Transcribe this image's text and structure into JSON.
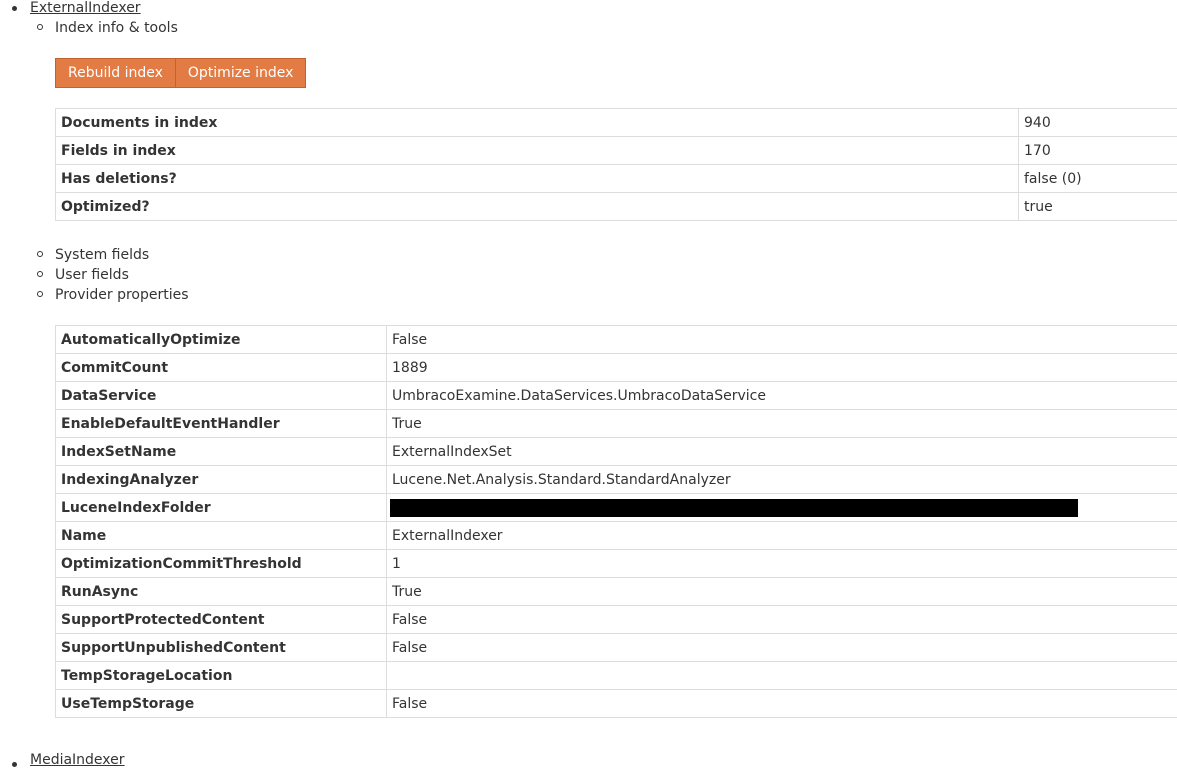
{
  "indexer": {
    "name": "ExternalIndexer",
    "info_tools_label": "Index info & tools",
    "buttons": {
      "rebuild": "Rebuild index",
      "optimize": "Optimize index"
    },
    "stats": [
      {
        "key": "Documents in index",
        "value": "940"
      },
      {
        "key": "Fields in index",
        "value": "170"
      },
      {
        "key": "Has deletions?",
        "value": "false (0)"
      },
      {
        "key": "Optimized?",
        "value": "true"
      }
    ],
    "sections": {
      "system_fields": "System fields",
      "user_fields": "User fields",
      "provider_properties": "Provider properties"
    },
    "properties": [
      {
        "key": "AutomaticallyOptimize",
        "value": "False"
      },
      {
        "key": "CommitCount",
        "value": "1889"
      },
      {
        "key": "DataService",
        "value": "UmbracoExamine.DataServices.UmbracoDataService"
      },
      {
        "key": "EnableDefaultEventHandler",
        "value": "True"
      },
      {
        "key": "IndexSetName",
        "value": "ExternalIndexSet"
      },
      {
        "key": "IndexingAnalyzer",
        "value": "Lucene.Net.Analysis.Standard.StandardAnalyzer"
      },
      {
        "key": "LuceneIndexFolder",
        "value": ""
      },
      {
        "key": "Name",
        "value": "ExternalIndexer"
      },
      {
        "key": "OptimizationCommitThreshold",
        "value": "1"
      },
      {
        "key": "RunAsync",
        "value": "True"
      },
      {
        "key": "SupportProtectedContent",
        "value": "False"
      },
      {
        "key": "SupportUnpublishedContent",
        "value": "False"
      },
      {
        "key": "TempStorageLocation",
        "value": ""
      },
      {
        "key": "UseTempStorage",
        "value": "False"
      }
    ]
  },
  "next_indexer": {
    "name": "MediaIndexer"
  },
  "colors": {
    "button_bg": "#e27c44",
    "button_border": "#c4622f",
    "table_border": "#dddddd",
    "text": "#343434",
    "redaction": "#000000"
  }
}
